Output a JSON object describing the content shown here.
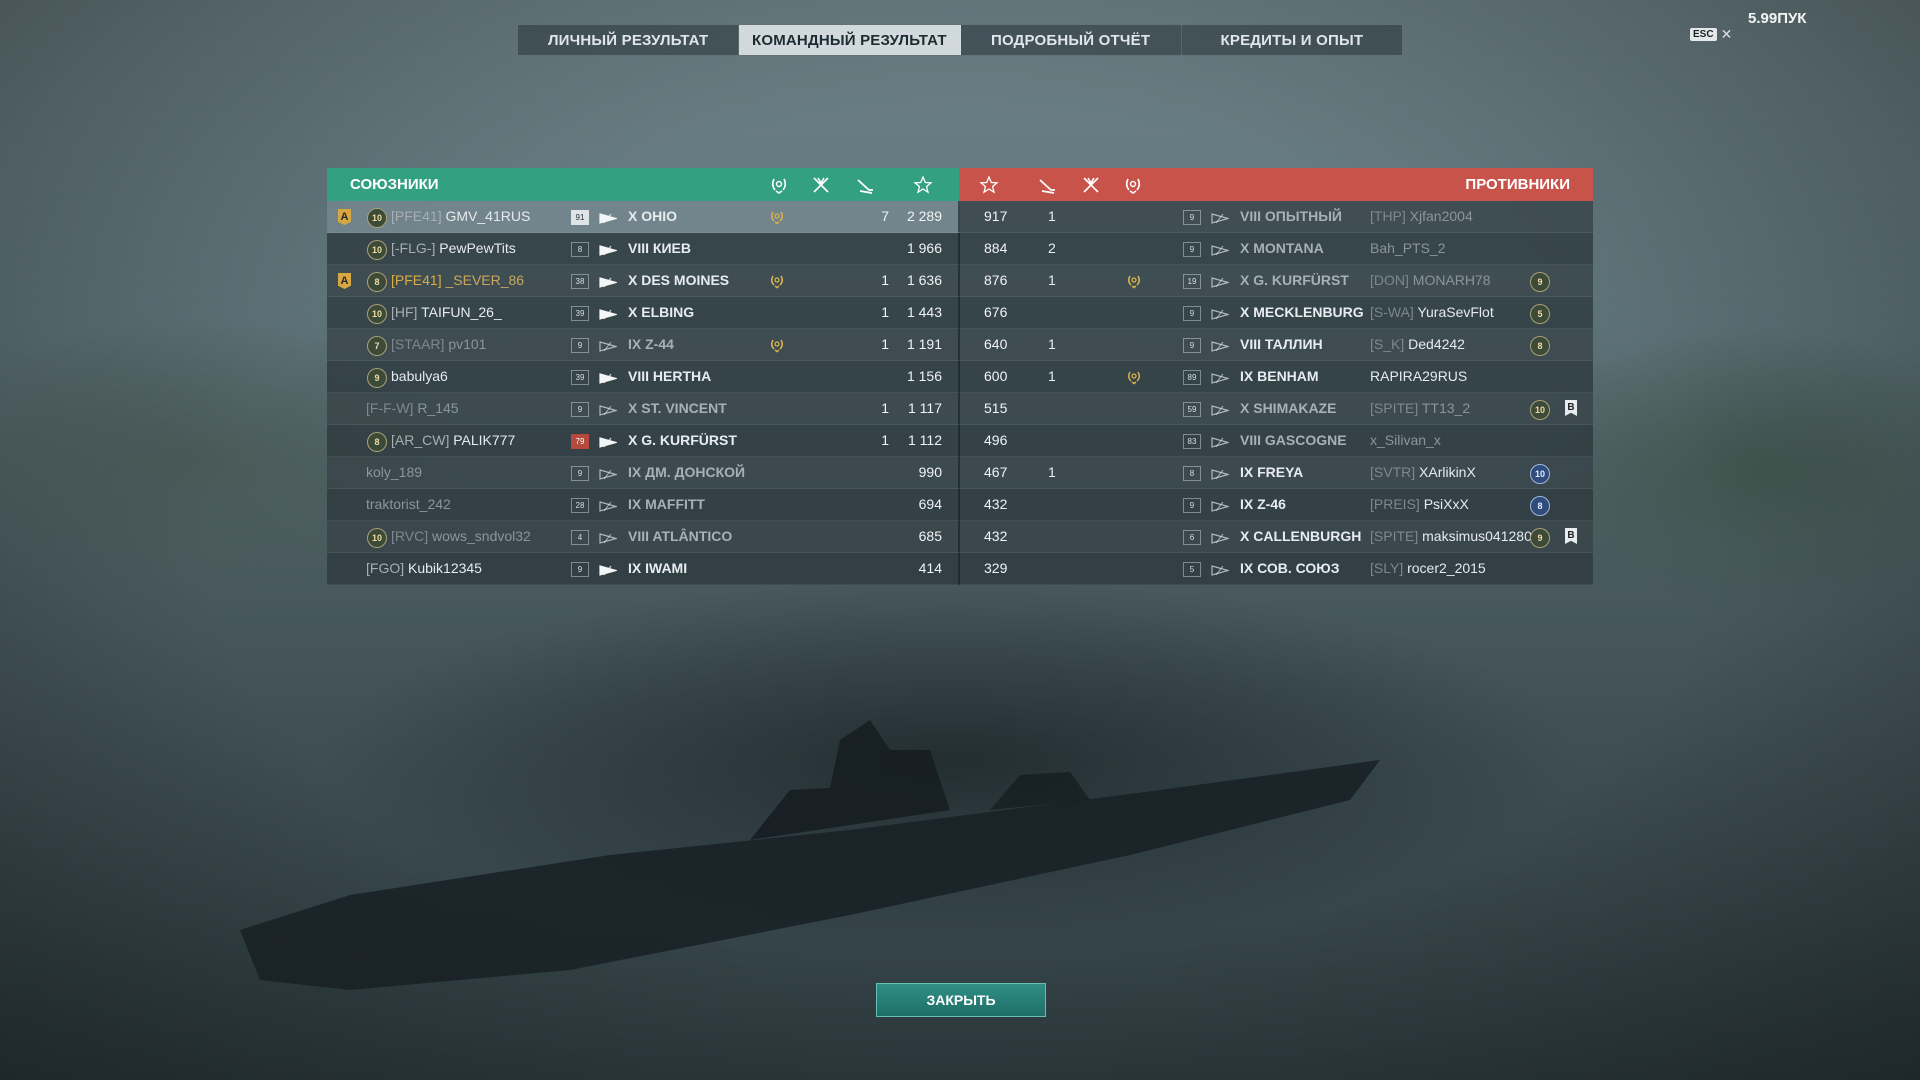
{
  "status": {
    "fps": "5.99ПУК",
    "esc_key": "ESC",
    "close_glyph": "✕"
  },
  "tabs": [
    {
      "label": "ЛИЧНЫЙ РЕЗУЛЬТАТ",
      "active": false
    },
    {
      "label": "КОМАНДНЫЙ РЕЗУЛЬТАТ",
      "active": true
    },
    {
      "label": "ПОДРОБНЫЙ ОТЧЁТ",
      "active": false
    },
    {
      "label": "КРЕДИТЫ И ОПЫТ",
      "active": false
    }
  ],
  "headers": {
    "allies": "СОЮЗНИКИ",
    "enemies": "ПРОТИВНИКИ"
  },
  "colors": {
    "allies": "#33a081",
    "enemies": "#c8534b",
    "gold": "#d9ad46"
  },
  "allies": [
    {
      "badge": "A",
      "rank": "10",
      "clan": "[PFE41]",
      "name": "GMV_41RUS",
      "level": "91",
      "ship": "X OHIO",
      "laurel": true,
      "kills": "7",
      "score": "2 289",
      "self": true
    },
    {
      "badge": "",
      "rank": "10",
      "clan": "[-FLG-]",
      "name": "PewPewTits",
      "level": "8",
      "ship": "VIII КИЕВ",
      "laurel": false,
      "kills": "",
      "score": "1 966"
    },
    {
      "badge": "A",
      "rank": "8",
      "clan": "[PFE41]",
      "name": "_SEVER_86",
      "level": "38",
      "ship": "X DES MOINES",
      "laurel": true,
      "kills": "1",
      "score": "1 636",
      "gold": true
    },
    {
      "badge": "",
      "rank": "10",
      "clan": "[HF]",
      "name": "TAIFUN_26_",
      "level": "39",
      "ship": "X ELBING",
      "laurel": false,
      "kills": "1",
      "score": "1 443"
    },
    {
      "badge": "",
      "rank": "7",
      "clan": "[STAAR]",
      "name": "pv101",
      "level": "9",
      "ship": "IX Z-44",
      "laurel": true,
      "kills": "1",
      "score": "1 191",
      "dim": true
    },
    {
      "badge": "",
      "rank": "9",
      "clan": "",
      "name": "babulya6",
      "level": "39",
      "ship": "VIII HERTHA",
      "laurel": false,
      "kills": "",
      "score": "1 156"
    },
    {
      "badge": "",
      "rank": "",
      "clan": "[F-F-W]",
      "name": "R_145",
      "level": "9",
      "ship": "X ST. VINCENT",
      "laurel": false,
      "kills": "1",
      "score": "1 117",
      "dim": true
    },
    {
      "badge": "",
      "rank": "8",
      "clan": "[AR_CW]",
      "name": "PALIK777",
      "level": "79",
      "ship": "X G. KURFÜRST",
      "laurel": false,
      "kills": "1",
      "score": "1 112"
    },
    {
      "badge": "",
      "rank": "",
      "clan": "",
      "name": "koly_189",
      "level": "9",
      "ship": "IX ДМ. ДОНСКОЙ",
      "laurel": false,
      "kills": "",
      "score": "990",
      "dim": true
    },
    {
      "badge": "",
      "rank": "",
      "clan": "",
      "name": "traktorist_242",
      "level": "28",
      "ship": "IX MAFFITT",
      "laurel": false,
      "kills": "",
      "score": "694",
      "dim": true
    },
    {
      "badge": "",
      "rank": "10",
      "clan": "[RVC]",
      "name": "wows_sndvol32",
      "level": "4",
      "ship": "VIII ATLÂNTICO",
      "laurel": false,
      "kills": "",
      "score": "685",
      "dim": true
    },
    {
      "badge": "",
      "rank": "",
      "clan": "[FGO]",
      "name": "Kubik12345",
      "level": "9",
      "ship": "IX IWAMI",
      "laurel": false,
      "kills": "",
      "score": "414"
    }
  ],
  "enemies": [
    {
      "score": "917",
      "kills": "1",
      "laurel": false,
      "level": "9",
      "ship": "VIII ОПЫТНЫЙ",
      "clan": "[THP]",
      "name": "Xjfan2004",
      "rank": "",
      "flag": "",
      "dim": true
    },
    {
      "score": "884",
      "kills": "2",
      "laurel": false,
      "level": "9",
      "ship": "X MONTANA",
      "clan": "",
      "name": "Bah_PTS_2",
      "rank": "",
      "flag": "",
      "dim": true
    },
    {
      "score": "876",
      "kills": "1",
      "laurel": true,
      "level": "19",
      "ship": "X G. KURFÜRST",
      "clan": "[DON]",
      "name": "MONARH78",
      "rank": "9",
      "flag": "",
      "dim": true
    },
    {
      "score": "676",
      "kills": "",
      "laurel": false,
      "level": "9",
      "ship": "X MECKLENBURG",
      "clan": "[S-WA]",
      "name": "YuraSevFlot",
      "rank": "5",
      "flag": ""
    },
    {
      "score": "640",
      "kills": "1",
      "laurel": false,
      "level": "9",
      "ship": "VIII ТАЛЛИН",
      "clan": "[S_K]",
      "name": "Ded4242",
      "rank": "8",
      "flag": ""
    },
    {
      "score": "600",
      "kills": "1",
      "laurel": true,
      "level": "89",
      "ship": "IX BENHAM",
      "clan": "",
      "name": "RAPIRA29RUS",
      "rank": "",
      "flag": ""
    },
    {
      "score": "515",
      "kills": "",
      "laurel": false,
      "level": "59",
      "ship": "X SHIMAKAZE",
      "clan": "[SPITE]",
      "name": "TT13_2",
      "rank": "10",
      "flag": "B",
      "dim": true
    },
    {
      "score": "496",
      "kills": "",
      "laurel": false,
      "level": "83",
      "ship": "VIII GASCOGNE",
      "clan": "",
      "name": "x_Silivan_x",
      "rank": "",
      "flag": "",
      "dim": true
    },
    {
      "score": "467",
      "kills": "1",
      "laurel": false,
      "level": "8",
      "ship": "IX FREYA",
      "clan": "[SVTR]",
      "name": "XArlikinX",
      "rank": "10",
      "flag": "",
      "blue": true
    },
    {
      "score": "432",
      "kills": "",
      "laurel": false,
      "level": "9",
      "ship": "IX Z-46",
      "clan": "[PREIS]",
      "name": "PsiXxX",
      "rank": "8",
      "flag": "",
      "blue": true
    },
    {
      "score": "432",
      "kills": "",
      "laurel": false,
      "level": "6",
      "ship": "X CALLENBURGH",
      "clan": "[SPITE]",
      "name": "maksimus041280",
      "rank": "9",
      "flag": "B"
    },
    {
      "score": "329",
      "kills": "",
      "laurel": false,
      "level": "5",
      "ship": "IX СОВ. СОЮЗ",
      "clan": "[SLY]",
      "name": "rocer2_2015",
      "rank": "",
      "flag": ""
    }
  ],
  "close_label": "ЗАКРЫТЬ"
}
